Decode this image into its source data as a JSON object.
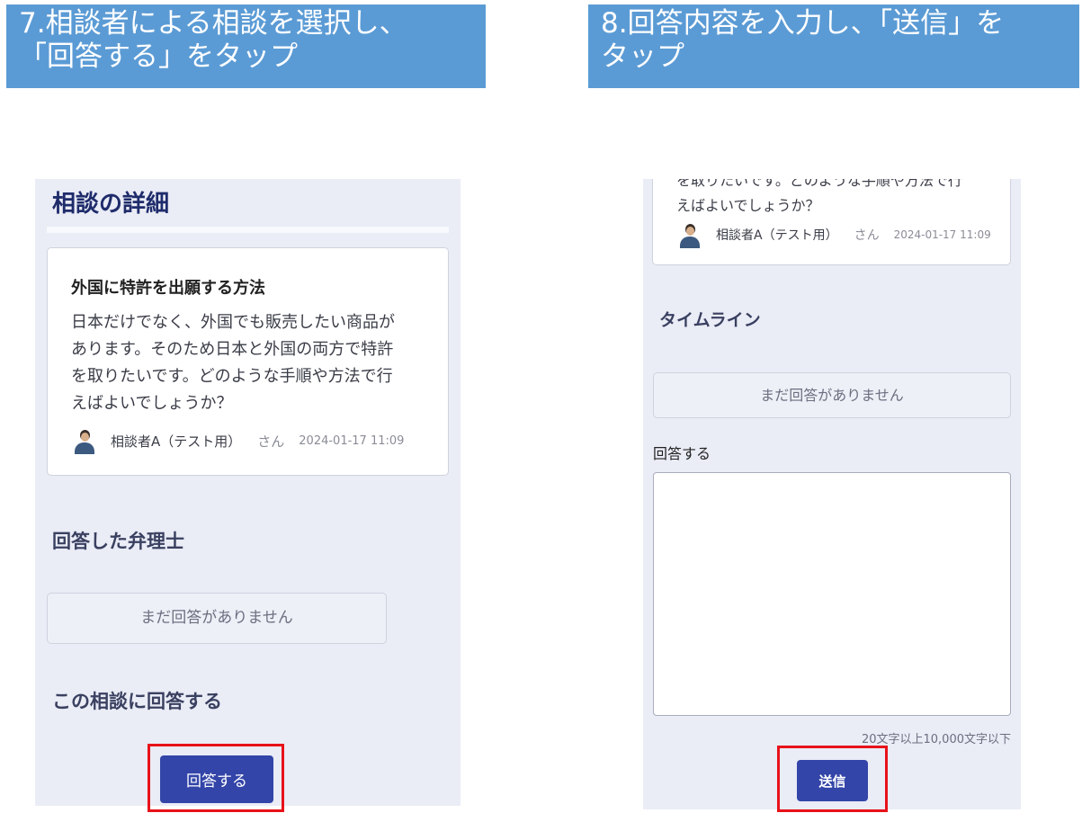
{
  "steps": [
    {
      "line1": "7.相談者による相談を選択し、",
      "line2": "「回答する」をタップ"
    },
    {
      "line1": "8.回答内容を入力し、「送信」を",
      "line2": "タップ"
    }
  ],
  "left": {
    "page_title": "相談の詳細",
    "question": {
      "title": "外国に特許を出願する方法",
      "body_lines": [
        "日本だけでなく、外国でも販売したい商品が",
        "あります。そのため日本と外国の両方で特許",
        "を取りたいです。どのような手順や方法で行",
        "えばよいでしょうか？"
      ],
      "author": "相談者A（テスト用）",
      "suffix": "さん",
      "date": "2024-01-17 11:09"
    },
    "answered_heading": "回答した弁理士",
    "no_answer": "まだ回答がありません",
    "reply_heading": "この相談に回答する",
    "reply_button": "回答する"
  },
  "right": {
    "partial_line": "を取りたいです。どのような手順や方法で行",
    "last_line": "えばよいでしょうか？",
    "author": "相談者A（テスト用）",
    "suffix": "さん",
    "date": "2024-01-17 11:09",
    "timeline_heading": "タイムライン",
    "no_answer": "まだ回答がありません",
    "answer_label": "回答する",
    "answer_value": "",
    "char_limit": "20文字以上10,000文字以下",
    "send_button": "送信"
  },
  "colors": {
    "banner": "#5b9bd5",
    "phone_bg": "#eaecf6",
    "primary": "#3345a8",
    "highlight": "#e8121a"
  }
}
